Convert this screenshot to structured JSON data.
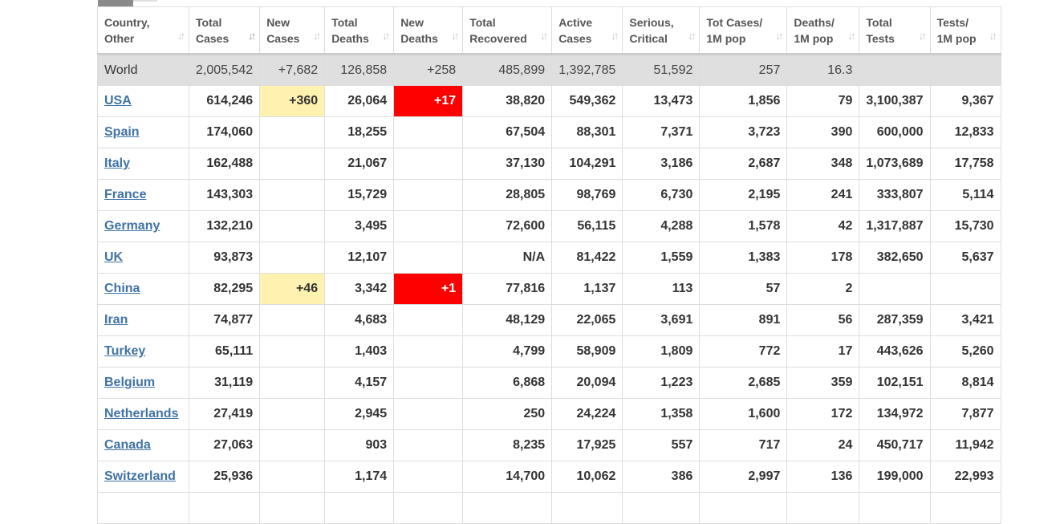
{
  "table": {
    "headers": [
      {
        "line1": "Country,",
        "line2": "Other",
        "sort": "↓↑",
        "active": false
      },
      {
        "line1": "Total",
        "line2": "Cases",
        "sort": "↓↑",
        "active": true
      },
      {
        "line1": "New",
        "line2": "Cases",
        "sort": "↓↑",
        "active": false
      },
      {
        "line1": "Total",
        "line2": "Deaths",
        "sort": "↓↑",
        "active": false
      },
      {
        "line1": "New",
        "line2": "Deaths",
        "sort": "↓↑",
        "active": false
      },
      {
        "line1": "Total",
        "line2": "Recovered",
        "sort": "↓↑",
        "active": false
      },
      {
        "line1": "Active",
        "line2": "Cases",
        "sort": "↓↑",
        "active": false
      },
      {
        "line1": "Serious,",
        "line2": "Critical",
        "sort": "↓↑",
        "active": false
      },
      {
        "line1": "Tot Cases/",
        "line2": "1M pop",
        "sort": "↓↑",
        "active": false
      },
      {
        "line1": "Deaths/",
        "line2": "1M pop",
        "sort": "↓↑",
        "active": false
      },
      {
        "line1": "Total",
        "line2": "Tests",
        "sort": "↓↑",
        "active": false
      },
      {
        "line1": "Tests/",
        "line2": "1M pop",
        "sort": "↓↑",
        "active": false
      }
    ],
    "world": [
      "World",
      "2,005,542",
      "+7,682",
      "126,858",
      "+258",
      "485,899",
      "1,392,785",
      "51,592",
      "257",
      "16.3",
      "",
      ""
    ],
    "rows": [
      [
        "USA",
        "614,246",
        "+360",
        "26,064",
        "+17",
        "38,820",
        "549,362",
        "13,473",
        "1,856",
        "79",
        "3,100,387",
        "9,367"
      ],
      [
        "Spain",
        "174,060",
        "",
        "18,255",
        "",
        "67,504",
        "88,301",
        "7,371",
        "3,723",
        "390",
        "600,000",
        "12,833"
      ],
      [
        "Italy",
        "162,488",
        "",
        "21,067",
        "",
        "37,130",
        "104,291",
        "3,186",
        "2,687",
        "348",
        "1,073,689",
        "17,758"
      ],
      [
        "France",
        "143,303",
        "",
        "15,729",
        "",
        "28,805",
        "98,769",
        "6,730",
        "2,195",
        "241",
        "333,807",
        "5,114"
      ],
      [
        "Germany",
        "132,210",
        "",
        "3,495",
        "",
        "72,600",
        "56,115",
        "4,288",
        "1,578",
        "42",
        "1,317,887",
        "15,730"
      ],
      [
        "UK",
        "93,873",
        "",
        "12,107",
        "",
        "N/A",
        "81,422",
        "1,559",
        "1,383",
        "178",
        "382,650",
        "5,637"
      ],
      [
        "China",
        "82,295",
        "+46",
        "3,342",
        "+1",
        "77,816",
        "1,137",
        "113",
        "57",
        "2",
        "",
        ""
      ],
      [
        "Iran",
        "74,877",
        "",
        "4,683",
        "",
        "48,129",
        "22,065",
        "3,691",
        "891",
        "56",
        "287,359",
        "3,421"
      ],
      [
        "Turkey",
        "65,111",
        "",
        "1,403",
        "",
        "4,799",
        "58,909",
        "1,809",
        "772",
        "17",
        "443,626",
        "5,260"
      ],
      [
        "Belgium",
        "31,119",
        "",
        "4,157",
        "",
        "6,868",
        "20,094",
        "1,223",
        "2,685",
        "359",
        "102,151",
        "8,814"
      ],
      [
        "Netherlands",
        "27,419",
        "",
        "2,945",
        "",
        "250",
        "24,224",
        "1,358",
        "1,600",
        "172",
        "134,972",
        "7,877"
      ],
      [
        "Canada",
        "27,063",
        "",
        "903",
        "",
        "8,235",
        "17,925",
        "557",
        "717",
        "24",
        "450,717",
        "11,942"
      ],
      [
        "Switzerland",
        "25,936",
        "",
        "1,174",
        "",
        "14,700",
        "10,062",
        "386",
        "2,997",
        "136",
        "199,000",
        "22,993"
      ],
      [
        "",
        "",
        "",
        "",
        "",
        "",
        "",
        "",
        "",
        "",
        "",
        ""
      ]
    ],
    "colors": {
      "new_cases_bg": "#fff2b0",
      "new_deaths_bg": "#ff0000",
      "link": "#3f73a5",
      "world_bg": "#dfdfdf"
    }
  }
}
